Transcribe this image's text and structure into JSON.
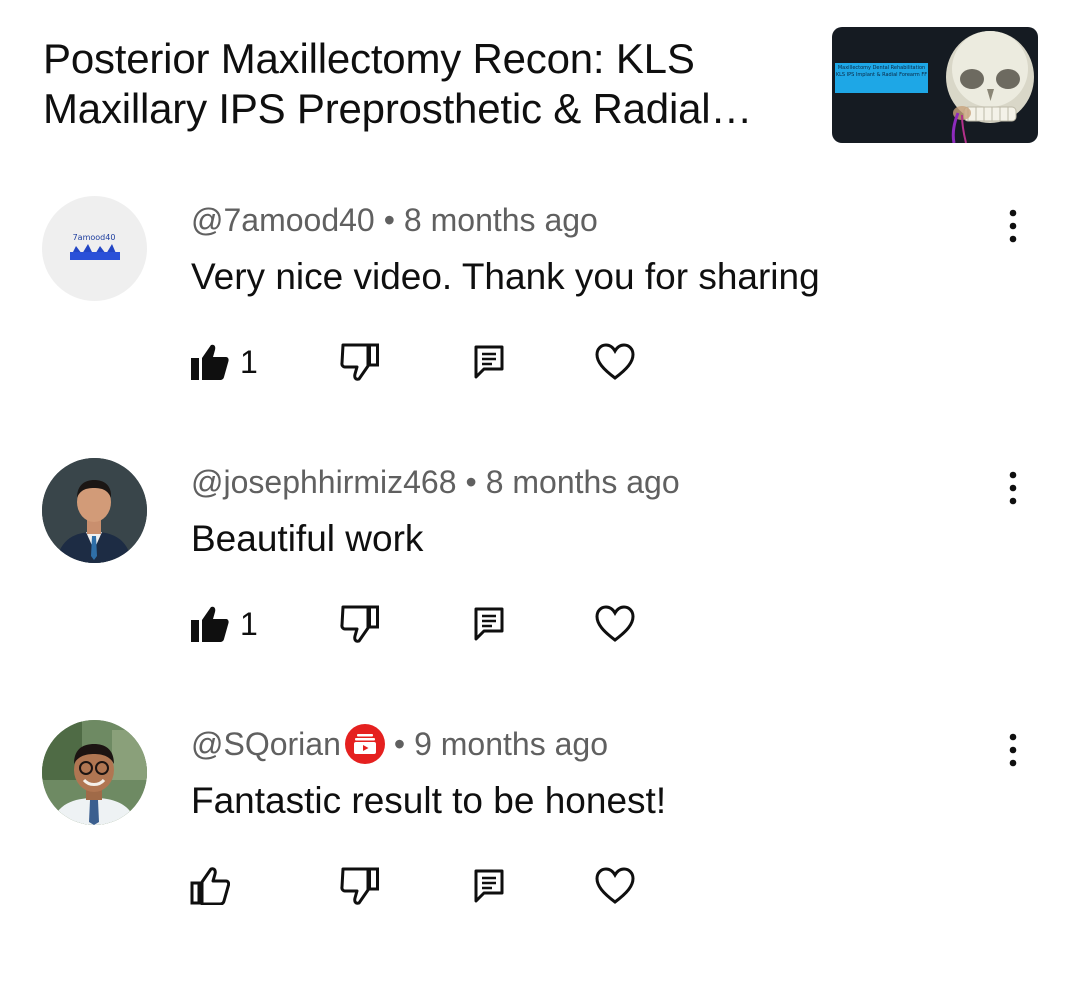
{
  "video": {
    "title": "Posterior Maxillectomy Recon: KLS Maxillary IPS Preprosthetic & Radial Forearm Free Flap",
    "thumbnail_caption": "Maxillectomy Dental Rehabilitation KLS IPS Implant & Radial Forearm FF"
  },
  "comments": [
    {
      "author": "@7amood40",
      "time": "8 months ago",
      "text": "Very nice video. Thank you for sharing",
      "likes": "1",
      "liked": true,
      "avatar_text": "7amood40"
    },
    {
      "author": "@josephhirmiz468",
      "time": "8 months ago",
      "text": "Beautiful work",
      "likes": "1",
      "liked": true
    },
    {
      "author": "@SQorian",
      "time": "9 months ago",
      "text": "Fantastic result to be honest!",
      "likes": "",
      "liked": false,
      "member_badge": true
    }
  ],
  "separator": "•",
  "icons": {
    "like": "thumbs-up-icon",
    "dislike": "thumbs-down-icon",
    "reply": "reply-icon",
    "heart": "heart-icon",
    "more": "more-vertical-icon"
  },
  "colors": {
    "text_primary": "#0f0f0f",
    "text_secondary": "#606060",
    "badge_red": "#e5201f"
  }
}
